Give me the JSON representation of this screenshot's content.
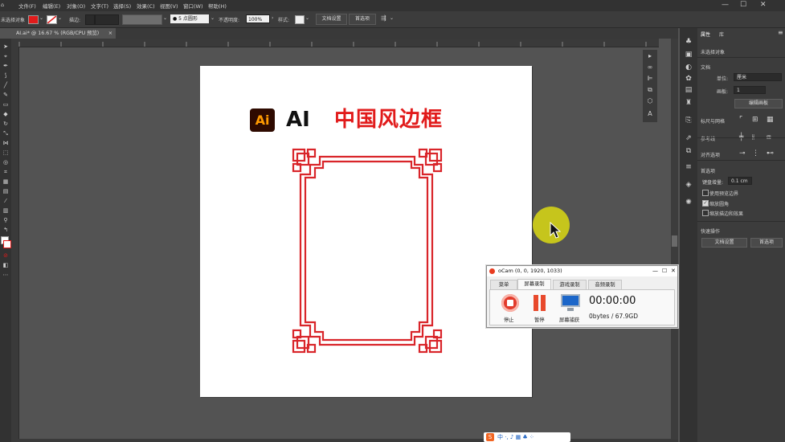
{
  "menubar": {
    "items": [
      "文件(F)",
      "编辑(E)",
      "对象(O)",
      "文字(T)",
      "选择(S)",
      "效果(C)",
      "视图(V)",
      "窗口(W)",
      "帮助(H)"
    ],
    "window_controls": [
      "—",
      "☐",
      "✕"
    ]
  },
  "control_bar": {
    "selection_label": "未选择对象",
    "stroke_label": "描边:",
    "stroke_value": "",
    "point_style": "5 点圆形",
    "opacity_label": "不透明度:",
    "opacity_value": "100%",
    "style_label": "样式:",
    "doc_setup_button": "文档设置",
    "prefs_button": "首选项"
  },
  "document_tab": {
    "label": "AI.ai* @ 16.67 % (RGB/CPU 预览)",
    "close": "×"
  },
  "artboard": {
    "logo_text": "Ai",
    "ai_text": "AI",
    "title": "中国风边框",
    "frame_color": "#d9252a"
  },
  "properties_panel": {
    "tabs": [
      "属性",
      "库"
    ],
    "no_selection": "未选择对象",
    "doc_section": "文档",
    "unit_label": "单位:",
    "unit_value": "厘米",
    "artboard_label": "画板:",
    "artboard_value": "1",
    "edit_artboard_button": "编辑画板",
    "rulers_grids": "标尺与网格",
    "guides": "参考线",
    "snap": "对齐选项",
    "prefs_section": "首选项",
    "keyboard_increment_label": "键盘增量:",
    "keyboard_increment_value": "0.1 cm",
    "checkboxes": [
      {
        "label": "使用预览边界",
        "checked": false
      },
      {
        "label": "缩放圆角",
        "checked": true
      },
      {
        "label": "缩放描边和效果",
        "checked": false
      }
    ],
    "quick_actions": "快速操作",
    "doc_setup_button": "文档设置",
    "prefs_button": "首选项"
  },
  "ocam": {
    "title": "oCam (0, 0, 1920, 1033)",
    "tabs": [
      "菜单",
      "屏幕录制",
      "游戏录制",
      "音频录制"
    ],
    "active_tab": "屏幕录制",
    "buttons": [
      "停止",
      "暂停",
      "屏幕捕获"
    ],
    "timer": "00:00:00",
    "size": "0bytes / 67.9GD"
  },
  "ime": {
    "text": "S 中 ·, ♪ ▦ ♣ 👕 ⁘"
  },
  "colors": {
    "accent_red": "#e11b1b",
    "ai_logo_bg": "#2e0a00",
    "ai_logo_fg": "#ff9a00",
    "cursor_highlight": "#c6c51c"
  }
}
